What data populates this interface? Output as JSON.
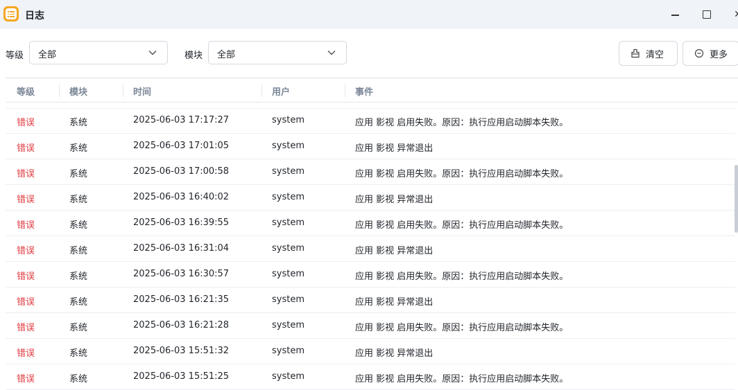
{
  "window": {
    "title": "日志"
  },
  "filters": {
    "level_label": "等级",
    "level_value": "全部",
    "module_label": "模块",
    "module_value": "全部",
    "clear_button": "清空",
    "more_button": "更多"
  },
  "table": {
    "headers": {
      "level": "等级",
      "module": "模块",
      "time": "时间",
      "user": "用户",
      "event": "事件"
    },
    "rows": [
      {
        "level": "错误",
        "module": "系统",
        "time": "2025-06-03 17:17:27",
        "user": "system",
        "event": "应用 影视 启用失败。原因：执行应用启动脚本失败。"
      },
      {
        "level": "错误",
        "module": "系统",
        "time": "2025-06-03 17:01:05",
        "user": "system",
        "event": "应用 影视 异常退出"
      },
      {
        "level": "错误",
        "module": "系统",
        "time": "2025-06-03 17:00:58",
        "user": "system",
        "event": "应用 影视 启用失败。原因：执行应用启动脚本失败。"
      },
      {
        "level": "错误",
        "module": "系统",
        "time": "2025-06-03 16:40:02",
        "user": "system",
        "event": "应用 影视 异常退出"
      },
      {
        "level": "错误",
        "module": "系统",
        "time": "2025-06-03 16:39:55",
        "user": "system",
        "event": "应用 影视 启用失败。原因：执行应用启动脚本失败。"
      },
      {
        "level": "错误",
        "module": "系统",
        "time": "2025-06-03 16:31:04",
        "user": "system",
        "event": "应用 影视 异常退出"
      },
      {
        "level": "错误",
        "module": "系统",
        "time": "2025-06-03 16:30:57",
        "user": "system",
        "event": "应用 影视 启用失败。原因：执行应用启动脚本失败。"
      },
      {
        "level": "错误",
        "module": "系统",
        "time": "2025-06-03 16:21:35",
        "user": "system",
        "event": "应用 影视 异常退出"
      },
      {
        "level": "错误",
        "module": "系统",
        "time": "2025-06-03 16:21:28",
        "user": "system",
        "event": "应用 影视 启用失败。原因：执行应用启动脚本失败。"
      },
      {
        "level": "错误",
        "module": "系统",
        "time": "2025-06-03 15:51:32",
        "user": "system",
        "event": "应用 影视 异常退出"
      },
      {
        "level": "错误",
        "module": "系统",
        "time": "2025-06-03 15:51:25",
        "user": "system",
        "event": "应用 影视 启用失败。原因：执行应用启动脚本失败。"
      }
    ]
  },
  "colors": {
    "error": "#e0393e",
    "titlebar_bg": "#f0f3f8",
    "header_text": "#7b8798",
    "app_icon": "#f5a623"
  }
}
